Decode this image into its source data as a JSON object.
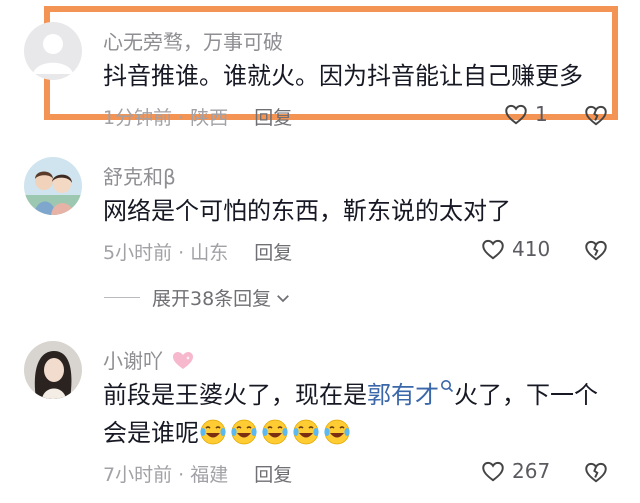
{
  "comments": [
    {
      "username": "心无旁骛，万事可破",
      "text": "抖音推谁。谁就火。因为抖音能让自己赚更多",
      "time": "1分钟前",
      "location": "陕西",
      "reply_label": "回复",
      "likes": "1"
    },
    {
      "username": "舒克和β",
      "text": "网络是个可怕的东西，靳东说的太对了",
      "time": "5小时前",
      "location": "山东",
      "reply_label": "回复",
      "likes": "410"
    },
    {
      "username": "小谢吖",
      "text_line1_a": "前段是王婆火了，现在是",
      "text_link": "郭有才",
      "text_line1_b": "火了，下一个",
      "text_line2": "会是谁呢",
      "emoji_count": 5,
      "time": "7小时前",
      "location": "福建",
      "reply_label": "回复",
      "likes": "267"
    }
  ],
  "expand_replies": "展开38条回复",
  "colors": {
    "highlight_border": "#f39354",
    "link": "#3a67a9",
    "text": "#161823",
    "meta": "#a1a1a6"
  },
  "icons": [
    "heart-outline-icon",
    "broken-heart-icon",
    "search-icon",
    "chevron-down-icon",
    "laughing-emoji-icon",
    "pink-heart-icon"
  ]
}
